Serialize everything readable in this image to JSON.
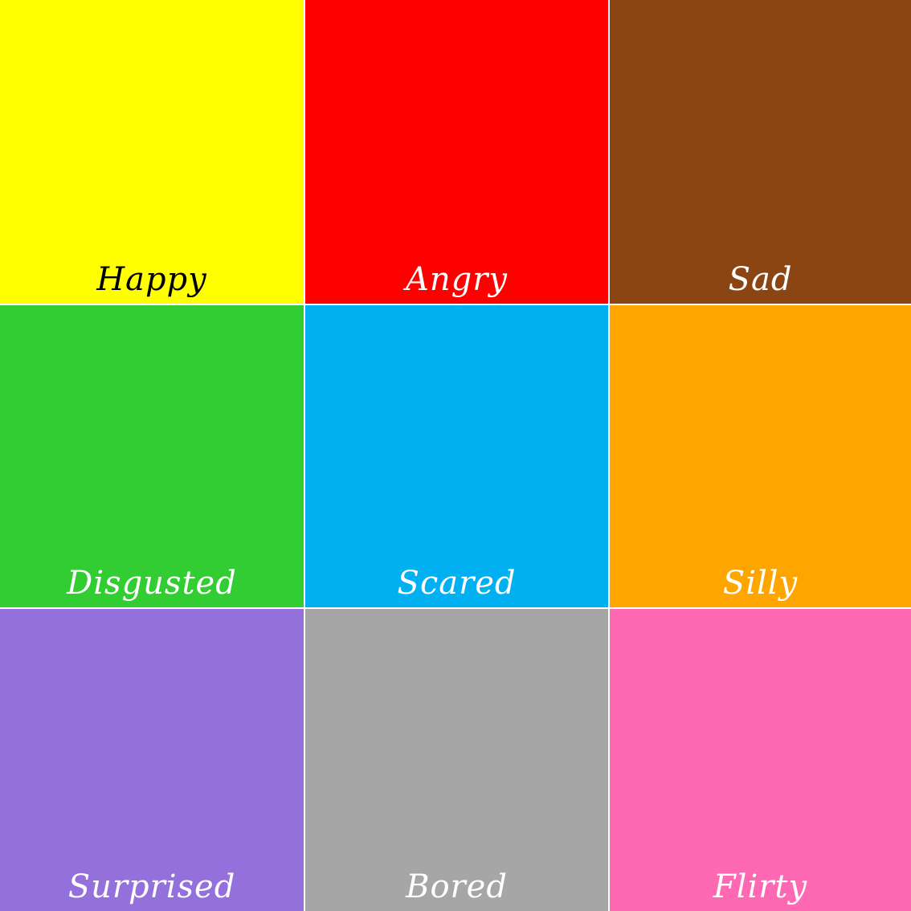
{
  "tiles": [
    {
      "label": "Happy",
      "color": "#ffff00",
      "text_color": "#000000"
    },
    {
      "label": "Angry",
      "color": "#ff0000",
      "text_color": "#ffffff"
    },
    {
      "label": "Sad",
      "color": "#8b4513",
      "text_color": "#ffffff"
    },
    {
      "label": "Disgusted",
      "color": "#32cd32",
      "text_color": "#ffffff"
    },
    {
      "label": "Scared",
      "color": "#00b0f0",
      "text_color": "#ffffff"
    },
    {
      "label": "Silly",
      "color": "#ffa500",
      "text_color": "#ffffff"
    },
    {
      "label": "Surprised",
      "color": "#9370db",
      "text_color": "#ffffff"
    },
    {
      "label": "Bored",
      "color": "#a6a6a6",
      "text_color": "#ffffff"
    },
    {
      "label": "Flirty",
      "color": "#ff69b4",
      "text_color": "#ffffff"
    }
  ]
}
